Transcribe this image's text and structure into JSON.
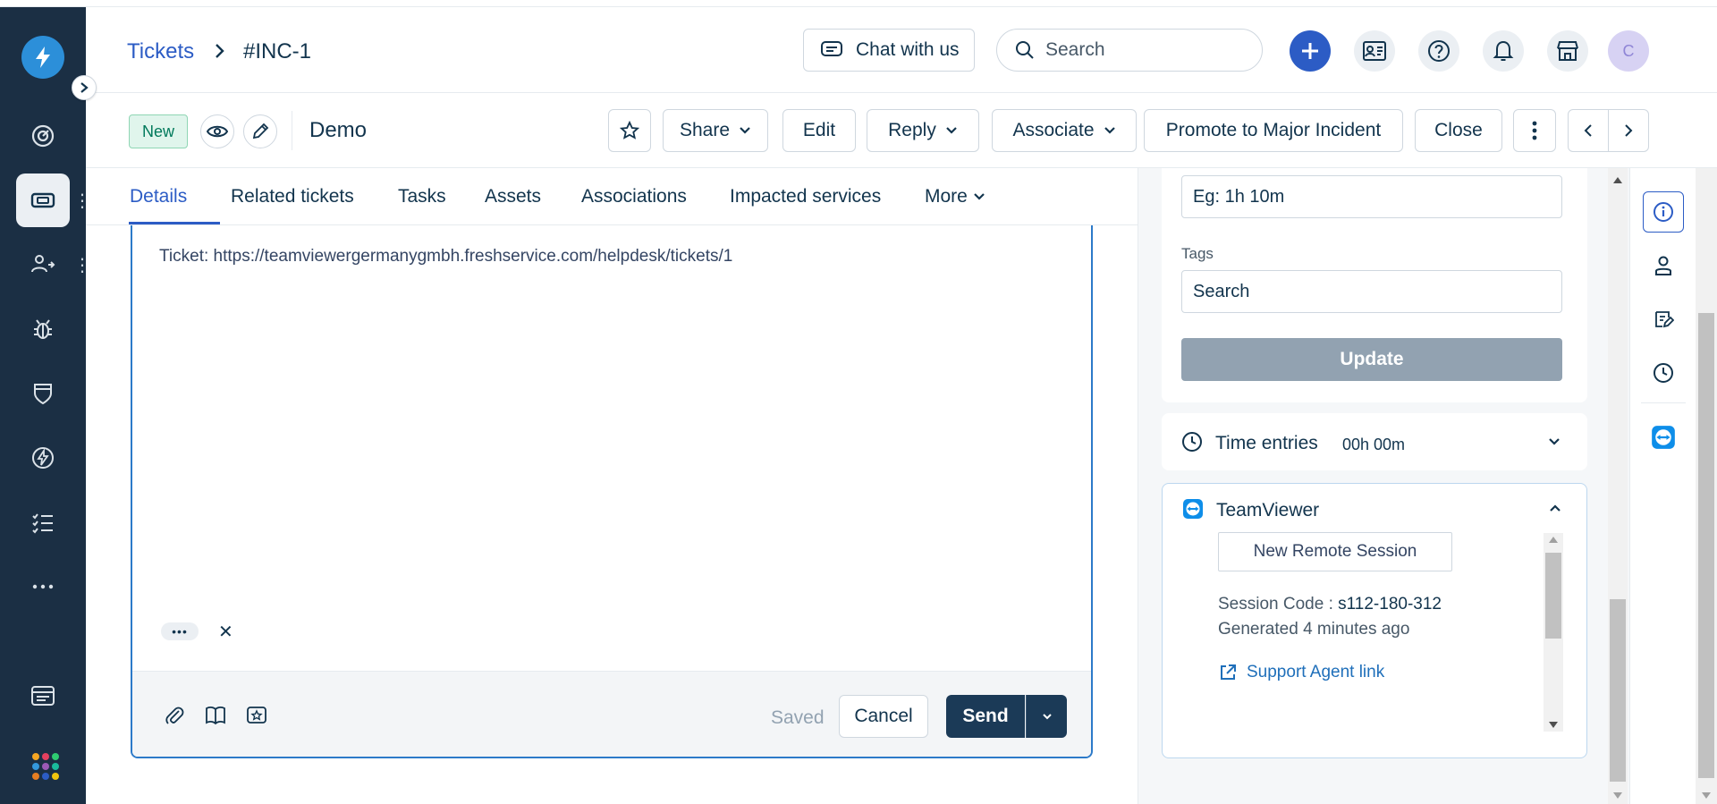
{
  "breadcrumb": {
    "link": "Tickets",
    "current": "#INC-1"
  },
  "topbar": {
    "chat_label": "Chat with us",
    "search_placeholder": "Search",
    "avatar_initial": "C"
  },
  "ticket": {
    "status": "New",
    "title": "Demo",
    "actions": {
      "share": "Share",
      "edit": "Edit",
      "reply": "Reply",
      "associate": "Associate",
      "promote": "Promote to Major Incident",
      "close": "Close"
    }
  },
  "tabs": [
    {
      "label": "Details"
    },
    {
      "label": "Related tickets"
    },
    {
      "label": "Tasks"
    },
    {
      "label": "Assets"
    },
    {
      "label": "Associations"
    },
    {
      "label": "Impacted services"
    },
    {
      "label": "More"
    }
  ],
  "editor": {
    "body": "Ticket: https://teamviewergermanygmbh.freshservice.com/helpdesk/tickets/1",
    "saved": "Saved",
    "cancel": "Cancel",
    "send": "Send"
  },
  "right_panel": {
    "time_input": "Eg: 1h 10m",
    "tags_label": "Tags",
    "tags_placeholder": "Search",
    "update": "Update",
    "time_entries": {
      "label": "Time entries",
      "value": "00h 00m"
    },
    "teamviewer": {
      "title": "TeamViewer",
      "new_session": "New Remote Session",
      "session_code_label": "Session Code : ",
      "session_code": "s112-180-312",
      "generated": "Generated 4 minutes ago",
      "support_link": "Support Agent link"
    }
  },
  "colors": {
    "nav_bg": "#1b2f44",
    "primary": "#2c5cc5",
    "send_bg": "#1b3a57",
    "teamviewer_blue": "#0e8ee9"
  }
}
